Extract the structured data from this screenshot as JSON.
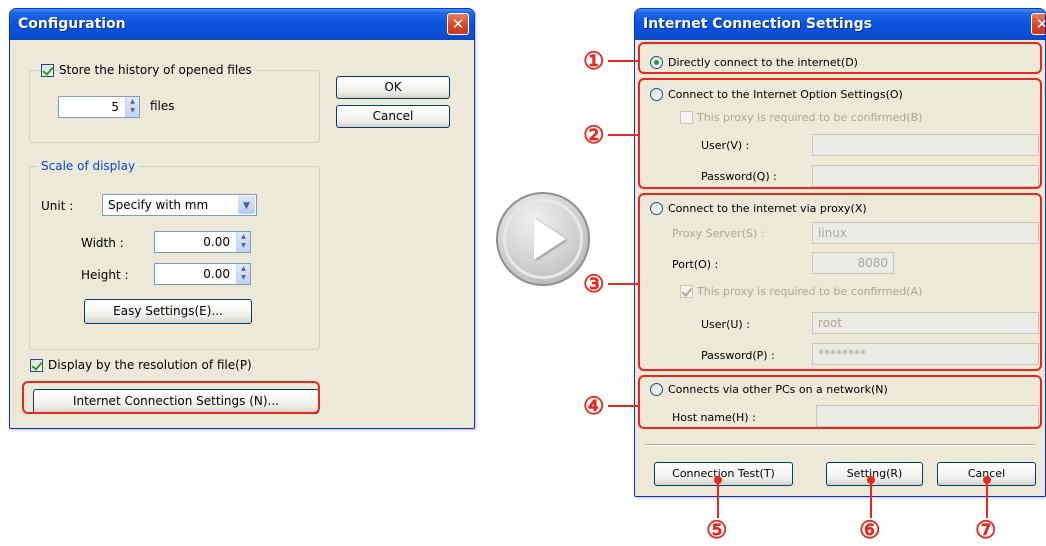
{
  "config": {
    "title": "Configuration",
    "store_history_label": "Store the history of opened files",
    "history_count": "5",
    "files_label": "files",
    "ok_label": "OK",
    "cancel_label": "Cancel",
    "scale_legend": "Scale of display",
    "unit_label": "Unit :",
    "unit_value": "Specify with mm",
    "width_label": "Width :",
    "width_value": "0.00",
    "height_label": "Height :",
    "height_value": "0.00",
    "easy_settings_label": "Easy Settings(E)...",
    "display_resolution_label": "Display by the resolution of file(P)",
    "internet_settings_label": "Internet Connection Settings (N)..."
  },
  "internet": {
    "title": "Internet Connection Settings",
    "direct_label": "Directly connect to the internet(D)",
    "option_settings_label": "Connect to the Internet Option Settings(O)",
    "option_proxy_confirm_label": "This proxy is required to be confirmed(B)",
    "option_user_label": "User(V) :",
    "option_user_value": "",
    "option_password_label": "Password(Q) :",
    "option_password_value": "",
    "via_proxy_label": "Connect to the internet via proxy(X)",
    "proxy_server_label": "Proxy Server(S) :",
    "proxy_server_value": "linux",
    "port_label": "Port(O) :",
    "port_value": "8080",
    "proxy_confirm_label": "This proxy is required to be confirmed(A)",
    "proxy_user_label": "User(U) :",
    "proxy_user_value": "root",
    "proxy_password_label": "Password(P) :",
    "proxy_password_value": "********",
    "other_pcs_label": "Connects via other PCs on a network(N)",
    "host_name_label": "Host name(H) :",
    "host_name_value": "",
    "connection_test_label": "Connection Test(T)",
    "setting_label": "Setting(R)",
    "cancel_label": "Cancel"
  },
  "markers": [
    "①",
    "②",
    "③",
    "④",
    "⑤",
    "⑥",
    "⑦"
  ],
  "colors": {
    "title_bar": "#0a4fd6",
    "dialog_bg": "#ece9d8",
    "annotation_red": "#e8271d"
  },
  "icons": [
    "close-icon",
    "play-icon",
    "spin-icon",
    "dropdown-arrow-icon"
  ]
}
